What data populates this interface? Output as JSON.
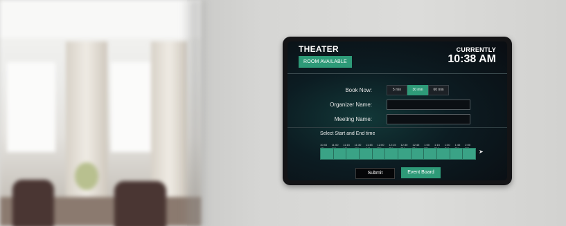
{
  "header": {
    "room_name": "THEATER",
    "status": "ROOM AVAILABLE",
    "currently_label": "CURRENTLY",
    "time": "10:38 AM"
  },
  "booking": {
    "book_now_label": "Book Now:",
    "durations": [
      {
        "label": "5 min",
        "active": false
      },
      {
        "label": "30 min",
        "active": true
      },
      {
        "label": "60 min",
        "active": false
      }
    ],
    "organizer_label": "Organizer Name:",
    "organizer_value": "",
    "meeting_label": "Meeting Name:",
    "meeting_value": ""
  },
  "timeline": {
    "title": "Select Start and End time",
    "times": [
      "10:45 AM",
      "11:00 AM",
      "11:15 AM",
      "11:30 AM",
      "11:45 AM",
      "12:00 PM",
      "12:15 PM",
      "12:30 PM",
      "12:45 PM",
      "1:00 PM",
      "1:15 PM",
      "1:30 PM",
      "1:45 PM",
      "2:00 PM"
    ],
    "slots": 12,
    "next_icon": "chevron-right-icon"
  },
  "actions": {
    "submit": "Submit",
    "event_board": "Event Board"
  },
  "colors": {
    "accent": "#2e9a78",
    "timeline": "#3aa386",
    "screen_bg": "#0a0d12"
  }
}
